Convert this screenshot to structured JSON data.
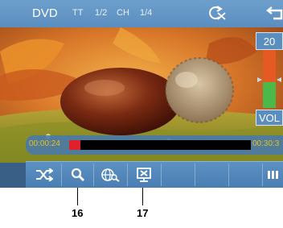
{
  "header": {
    "source": "DVD",
    "title_label": "TT",
    "title_value": "1/2",
    "chapter_label": "CH",
    "chapter_value": "1/4"
  },
  "icons": {
    "repeat": "repeat-off-icon",
    "back": "back-icon",
    "shuffle": "shuffle-icon",
    "search": "search-icon",
    "zoom": "globe-zoom-icon",
    "screen_off": "screen-off-icon",
    "more": "more-icon"
  },
  "volume": {
    "value": "20",
    "label": "VOL",
    "level": 0.45
  },
  "playback": {
    "elapsed": "00:00:24",
    "total": "00:30:3",
    "progress": 0.06
  },
  "callouts": {
    "search": "16",
    "screen_off": "17"
  },
  "colors": {
    "bar": "#5b8ec0",
    "progress": "#e0202a",
    "time": "#e8c020"
  }
}
